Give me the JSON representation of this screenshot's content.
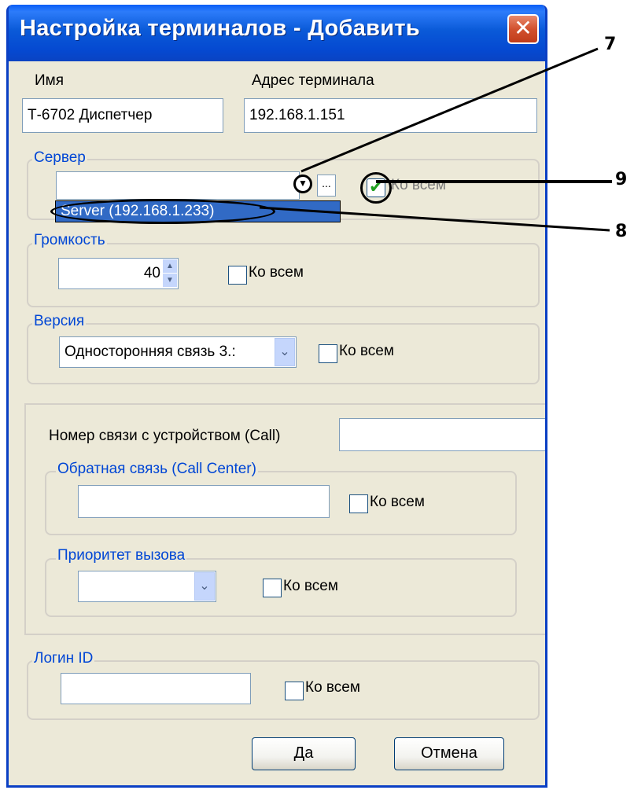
{
  "window": {
    "title": "Настройка терминалов - Добавить",
    "close_glyph": "✕"
  },
  "fields": {
    "name_label": "Имя",
    "name_value": "Т-6702 Диспетчер",
    "address_label": "Адрес терминала",
    "address_value": "192.168.1.151"
  },
  "server_group": {
    "legend": "Сервер",
    "browse_label": "...",
    "dropdown_option": "Server (192.168.1.233)",
    "to_all_label": "Ко всем",
    "to_all_checked": true
  },
  "volume_group": {
    "legend": "Громкость",
    "value": "40",
    "to_all_label": "Ко всем"
  },
  "version_group": {
    "legend": "Версия",
    "selected": "Односторонняя связь 3.:",
    "to_all_label": "Ко всем"
  },
  "call_panel": {
    "call_number_label": "Номер связи с устройством (Call)",
    "call_center_legend": "Обратная связь (Call Center)",
    "call_center_to_all": "Ко всем",
    "priority_legend": "Приоритет вызова",
    "priority_to_all": "Ко всем"
  },
  "login_group": {
    "legend": "Логин ID",
    "to_all_label": "Ко всем"
  },
  "buttons": {
    "ok": "Да",
    "cancel": "Отмена"
  },
  "annotations": [
    "7",
    "8",
    "9"
  ],
  "colors": {
    "title_bar": "#0a5ad8",
    "dialog_bg": "#ece9d8",
    "legend_text": "#0046d5",
    "selection": "#316ac5"
  }
}
